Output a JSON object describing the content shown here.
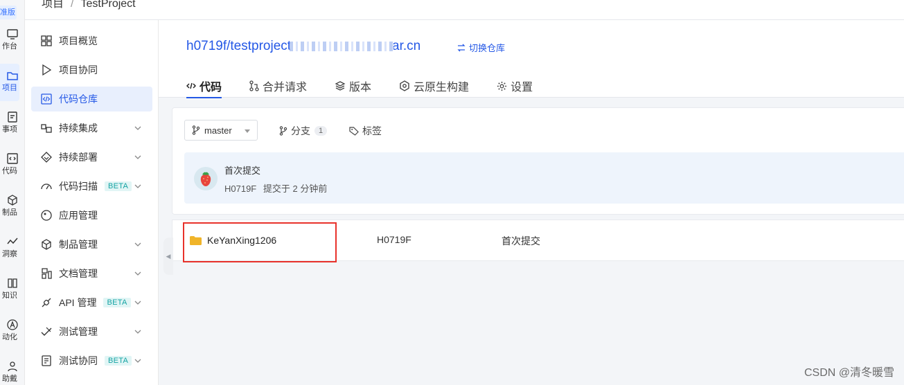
{
  "breadcrumb": {
    "project": "项目",
    "separator": "/",
    "current": "TestProject"
  },
  "rail": {
    "badge": "准版",
    "items": [
      {
        "label": "作台",
        "icon": "dashboard-icon"
      },
      {
        "label": "项目",
        "icon": "project-icon"
      },
      {
        "label": "事项",
        "icon": "issue-icon"
      },
      {
        "label": "代码",
        "icon": "code-icon"
      },
      {
        "label": "制品",
        "icon": "artifact-icon"
      },
      {
        "label": "洞察",
        "icon": "insight-icon"
      },
      {
        "label": "知识",
        "icon": "book-icon"
      },
      {
        "label": "动化",
        "icon": "automation-icon"
      },
      {
        "label": "助戴",
        "icon": "user-icon"
      }
    ]
  },
  "sidebar": {
    "items": [
      {
        "label": "项目概览",
        "icon": "grid-icon",
        "expandable": false,
        "beta": ""
      },
      {
        "label": "项目协同",
        "icon": "play-icon",
        "expandable": false,
        "beta": ""
      },
      {
        "label": "代码仓库",
        "icon": "code-repo-icon",
        "expandable": false,
        "beta": "",
        "active": true
      },
      {
        "label": "持续集成",
        "icon": "ci-icon",
        "expandable": true,
        "beta": ""
      },
      {
        "label": "持续部署",
        "icon": "deploy-icon",
        "expandable": true,
        "beta": ""
      },
      {
        "label": "代码扫描",
        "icon": "gauge-icon",
        "expandable": true,
        "beta": "BETA"
      },
      {
        "label": "应用管理",
        "icon": "app-icon",
        "expandable": false,
        "beta": ""
      },
      {
        "label": "制品管理",
        "icon": "cube-icon",
        "expandable": true,
        "beta": ""
      },
      {
        "label": "文档管理",
        "icon": "doc-icon",
        "expandable": true,
        "beta": ""
      },
      {
        "label": "API 管理",
        "icon": "api-icon",
        "expandable": true,
        "beta": "BETA"
      },
      {
        "label": "测试管理",
        "icon": "test-icon",
        "expandable": true,
        "beta": ""
      },
      {
        "label": "测试协同",
        "icon": "checklist-icon",
        "expandable": true,
        "beta": "BETA"
      }
    ]
  },
  "repo": {
    "title_prefix": "h0719f/testproject",
    "title_suffix": "ar.cn",
    "switch_label": "切换仓库"
  },
  "tabs": [
    {
      "label": "代码",
      "icon": "code-tag-icon",
      "active": true
    },
    {
      "label": "合并请求",
      "icon": "merge-request-icon"
    },
    {
      "label": "版本",
      "icon": "layers-icon"
    },
    {
      "label": "云原生构建",
      "icon": "cloud-build-icon"
    },
    {
      "label": "设置",
      "icon": "settings-icon"
    }
  ],
  "branch": {
    "selected": "master",
    "branches_label": "分支",
    "branches_count": "1",
    "tags_label": "标签"
  },
  "latest_commit": {
    "message": "首次提交",
    "author": "H0719F",
    "meta_text": "提交于 2 分钟前"
  },
  "files": [
    {
      "name": "KeYanXing1206",
      "type": "folder",
      "author": "H0719F",
      "message": "首次提交"
    }
  ],
  "watermark": "CSDN @清冬暖雪",
  "colors": {
    "accent": "#2458e6",
    "active_bg": "#e8effd",
    "highlight": "#e8312a",
    "folder": "#f0b429"
  }
}
